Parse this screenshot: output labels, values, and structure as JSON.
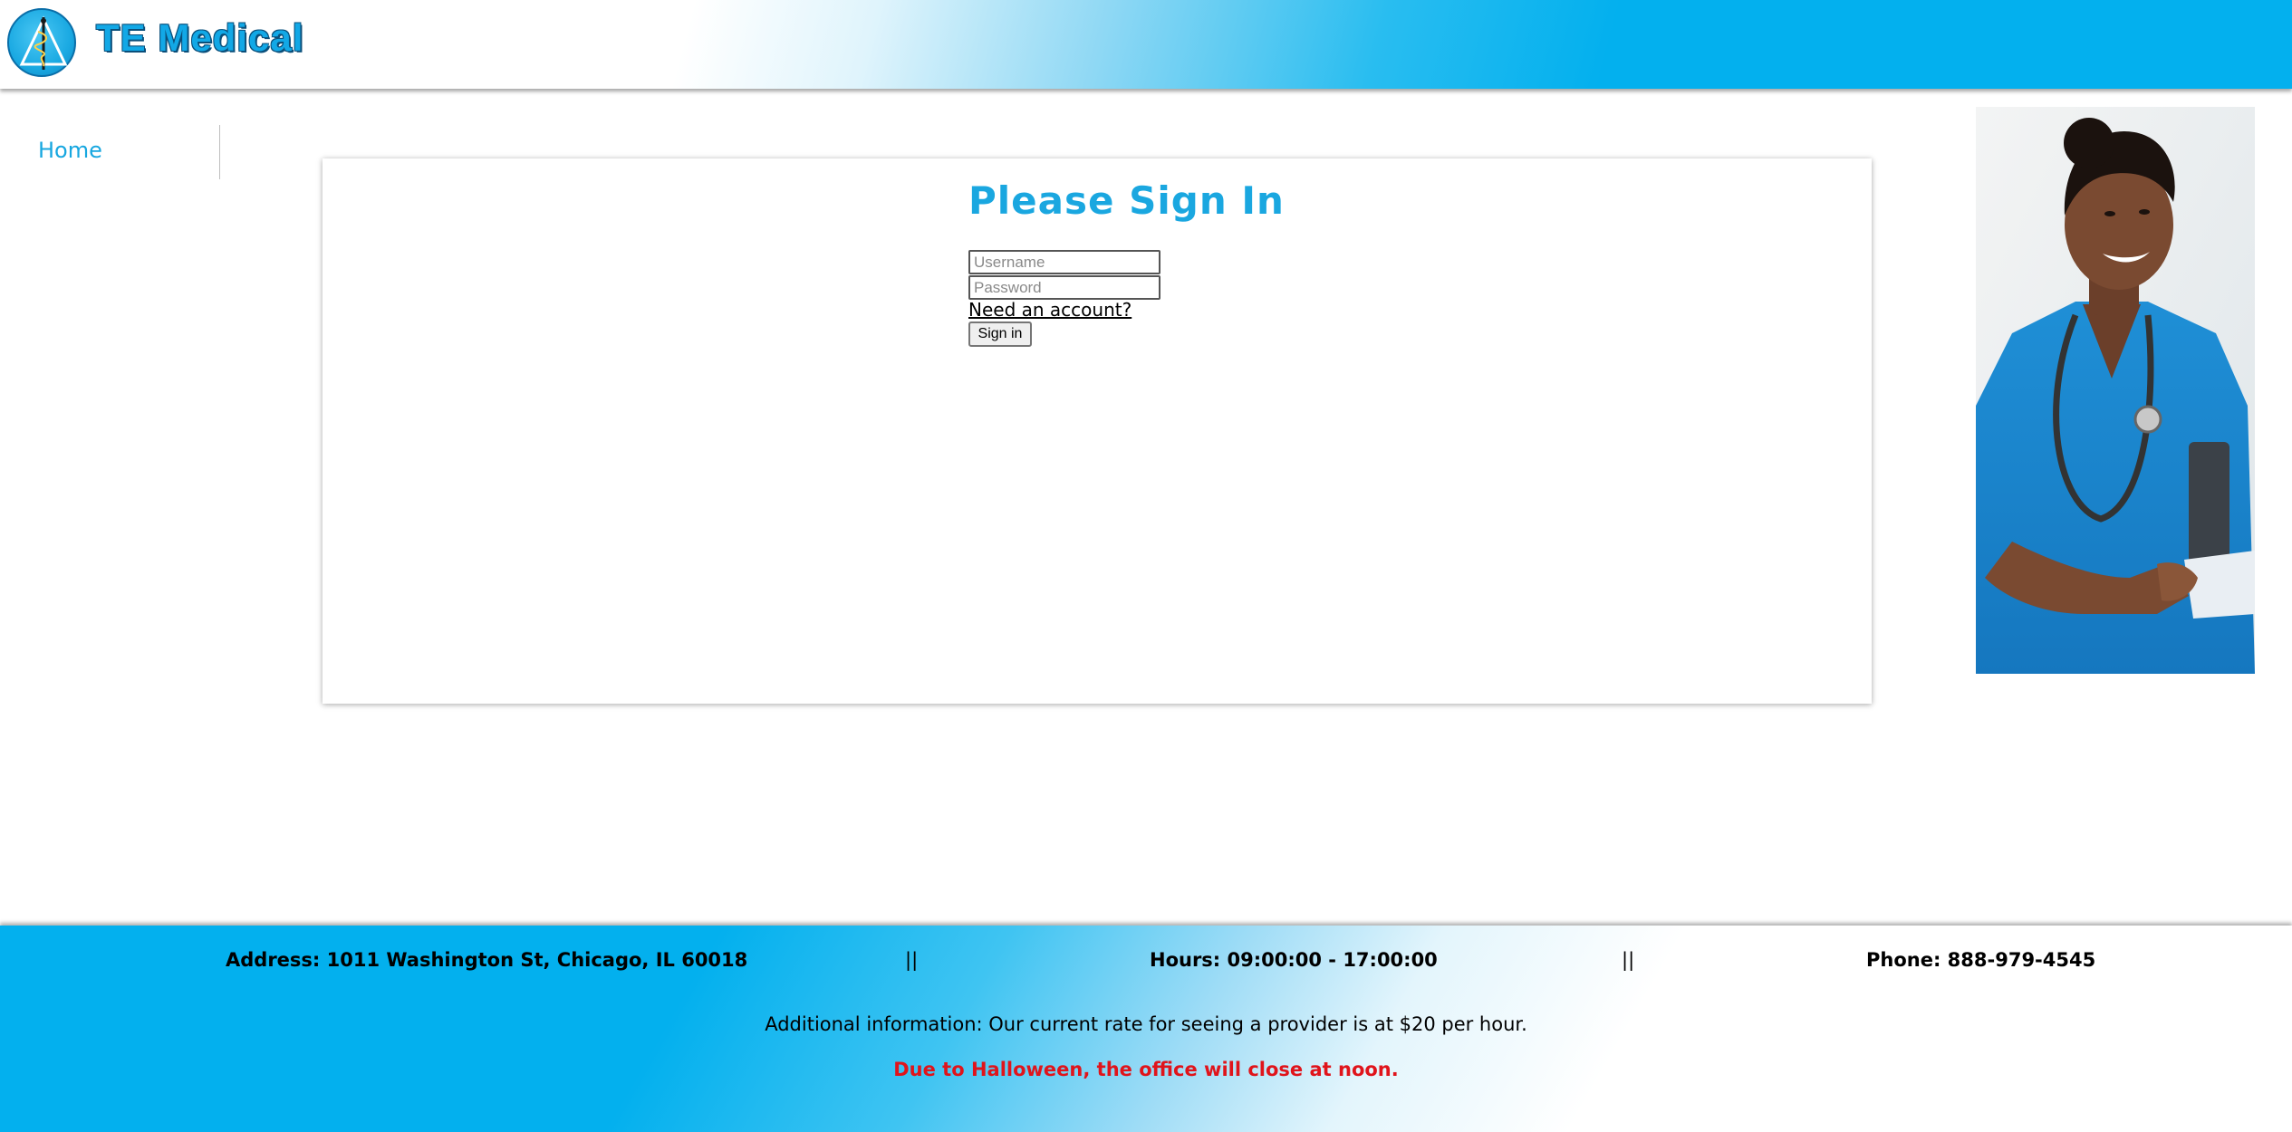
{
  "header": {
    "brand": "TE Medical",
    "logo_icon": "caduceus-icon",
    "colors": {
      "primary": "#03b0ee",
      "brand_text": "#12a8e6"
    }
  },
  "sidebar": {
    "items": [
      {
        "label": "Home"
      }
    ]
  },
  "signin": {
    "title": "Please Sign In",
    "username_placeholder": "Username",
    "password_placeholder": "Password",
    "account_link": "Need an account?",
    "button_label": "Sign in"
  },
  "footer": {
    "address": "Address: 1011 Washington St, Chicago, IL 60018",
    "separator": "||",
    "hours": "Hours: 09:00:00 - 17:00:00",
    "phone": "Phone: 888-979-4545",
    "additional_info": "Additional information: Our current rate for seeing a provider is at $20 per hour.",
    "notice": "Due to Halloween, the office will close at noon.",
    "notice_color": "#e0141b"
  }
}
